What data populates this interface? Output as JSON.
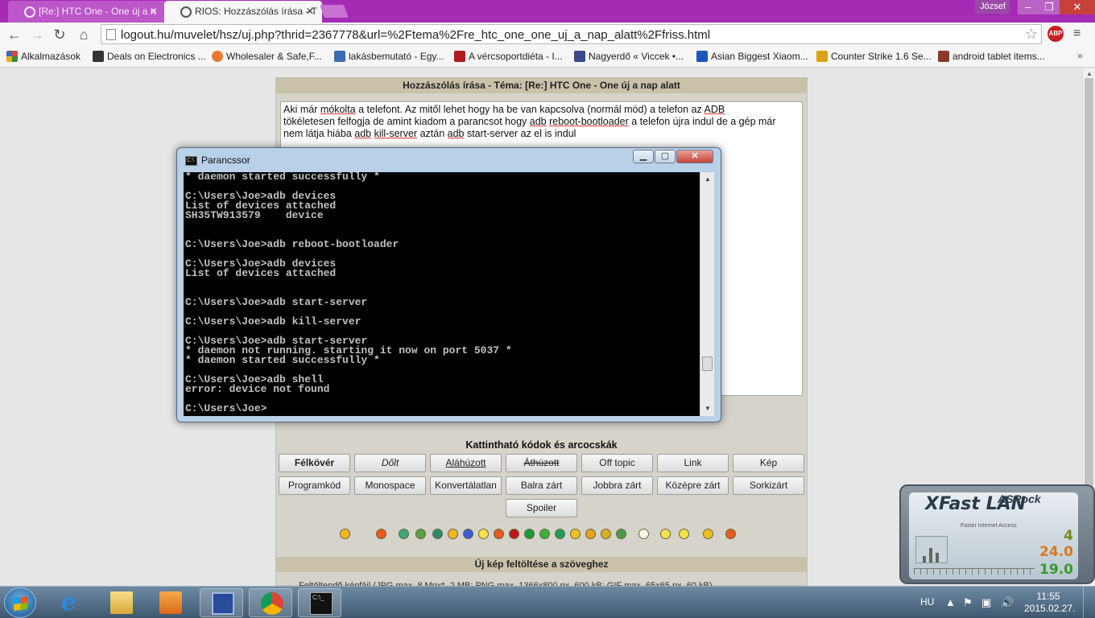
{
  "browser": {
    "tabs": [
      {
        "title": "[Re:] HTC One - One új a n",
        "active": false
      },
      {
        "title": "RIOS: Hozzászólás írása - T",
        "active": true
      }
    ],
    "user": "József",
    "url": "logout.hu/muvelet/hsz/uj.php?thrid=2367778&url=%2Ftema%2Fre_htc_one_one_uj_a_nap_alatt%2Ffriss.html",
    "abp": "ABP",
    "bookmarks": [
      {
        "label": "Alkalmazások",
        "color": "#d04a3a"
      },
      {
        "label": "Deals on Electronics ...",
        "color": "#333333"
      },
      {
        "label": "Wholesaler & Safe,F...",
        "color": "#e87a2c"
      },
      {
        "label": "lakásbemutató - Egy...",
        "color": "#3b6ab5"
      },
      {
        "label": "A vércsoportdiéta - I...",
        "color": "#b01c1c"
      },
      {
        "label": "Nagyerdő « Viccek •...",
        "color": "#3a4a8a"
      },
      {
        "label": "Asian Biggest Xiaom...",
        "color": "#1d56b8"
      },
      {
        "label": "Counter Strike 1.6 Se...",
        "color": "#d8a21a"
      },
      {
        "label": "android tablet items...",
        "color": "#8b3a2a"
      }
    ],
    "bookmarks_more": "»"
  },
  "page": {
    "header": "Hozzászólás írása - Téma: [Re:] HTC One - One új a nap alatt",
    "editor": {
      "p1": "Aki már ",
      "w1": "mókolta",
      "p2": " a telefont. Az mitől lehet hogy ha be van kapcsolva (normál mód) a telefon az ",
      "w2": "ADB",
      "p3": "tökéletesen felfogja de amint kiadom a parancsot hogy ",
      "w3": "adb",
      "p3b": " ",
      "w4": "reboot-bootloader",
      "p4": " a telefon újra indul  de a gép már",
      "p5": "nem látja hiába ",
      "w5": "adb",
      "p5b": " ",
      "w6": "kill-server",
      "p6": " aztán ",
      "w7": "adb",
      "p7": " start-server az el is indul"
    },
    "codes_title": "Kattintható kódok és arcocskák",
    "buttons_row1": [
      "Félkövér",
      "Dőlt",
      "Aláhúzott",
      "Áthúzott",
      "Off topic",
      "Link",
      "Kép"
    ],
    "buttons_row2": [
      "Programkód",
      "Monospace",
      "Konvertálatlan",
      "Balra zárt",
      "Jobbra zárt",
      "Középre zárt",
      "Sorkizárt"
    ],
    "button_spoiler": "Spoiler",
    "upload_header": "Új kép feltöltése a szöveghez",
    "upload_text": "Feltöltendő képfájl (JPG max. 8 Mpx*, 2 MB; PNG max. 1366x800 px, 600 kB; GIF max. 65x65 px, 60 kB)"
  },
  "cmd": {
    "title": "Parancssor",
    "output": "* daemon started successfully *\n\nC:\\Users\\Joe>adb devices\nList of devices attached\nSH35TW913579    device\n\n\nC:\\Users\\Joe>adb reboot-bootloader\n\nC:\\Users\\Joe>adb devices\nList of devices attached\n\n\nC:\\Users\\Joe>adb start-server\n\nC:\\Users\\Joe>adb kill-server\n\nC:\\Users\\Joe>adb start-server\n* daemon not running. starting it now on port 5037 *\n* daemon started successfully *\n\nC:\\Users\\Joe>adb shell\nerror: device not found\n\nC:\\Users\\Joe>"
  },
  "gadget": {
    "brand": "ASRock",
    "name": "XFast LAN",
    "subtitle": "Faster Internet Access",
    "value_1": "4",
    "value_2": "24.0",
    "value_3": "19.0"
  },
  "taskbar": {
    "language": "HU",
    "time": "11:55",
    "date": "2015.02.27."
  }
}
